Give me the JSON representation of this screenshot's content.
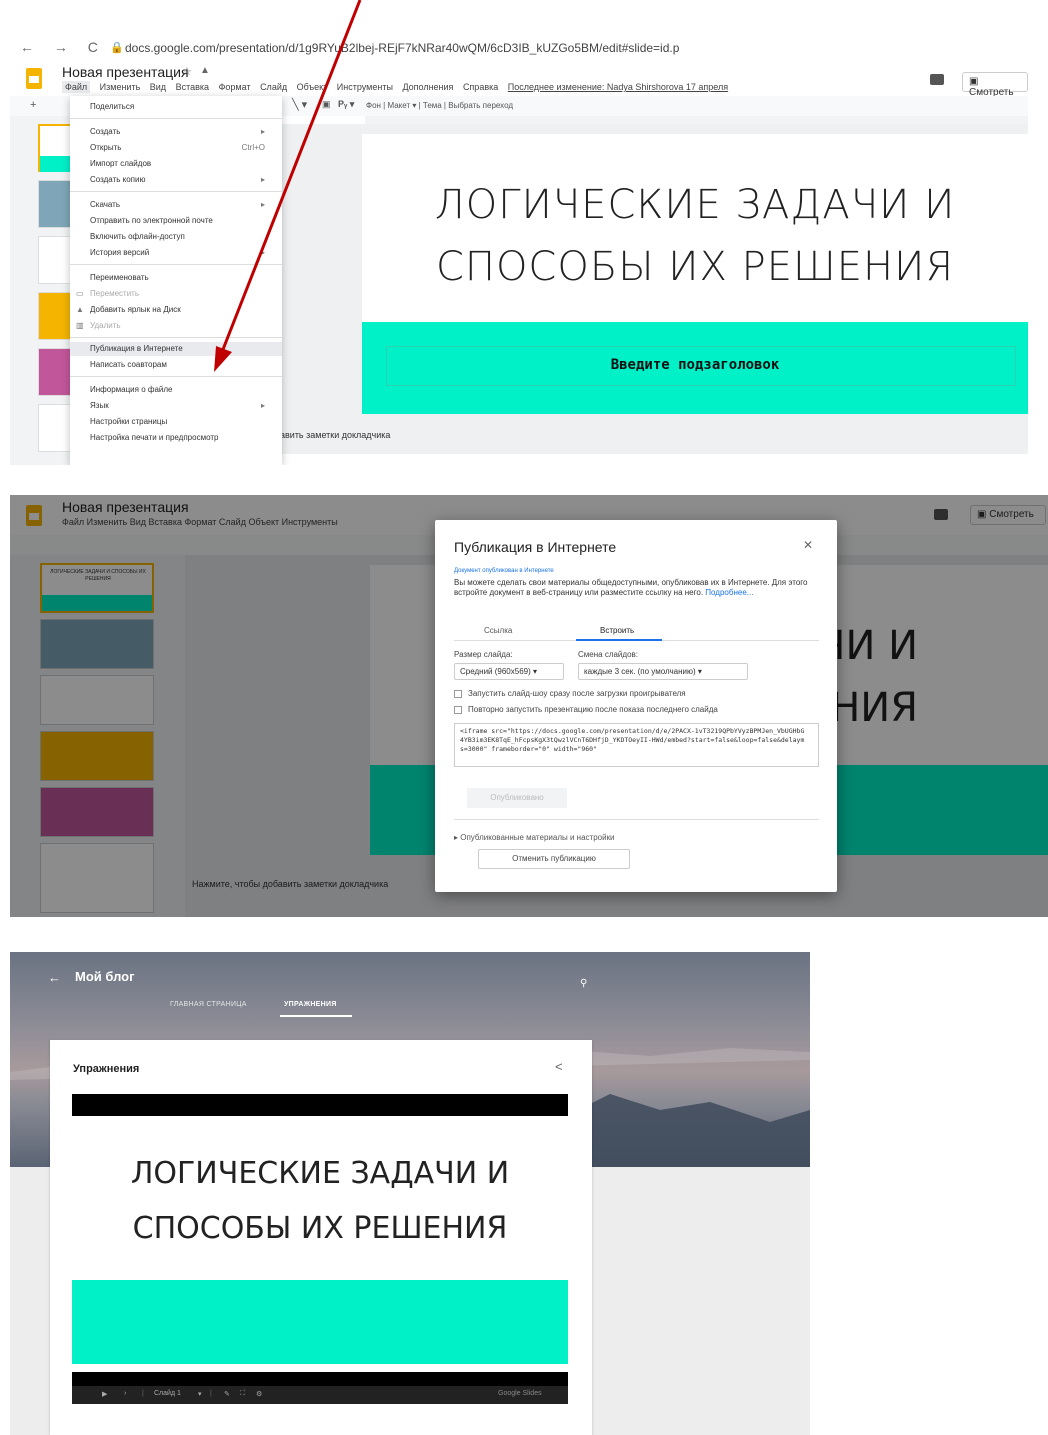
{
  "screen1": {
    "url": "docs.google.com/presentation/d/1g9RYuB2lbej-REjF7kNRar40wQM/6cD3IB_kUZGo5BM/edit#slide=id.p",
    "doc_title": "Новая презентация",
    "menus": [
      "Файл",
      "Изменить",
      "Вид",
      "Вставка",
      "Формат",
      "Слайд",
      "Объект",
      "Инструменты",
      "Дополнения",
      "Справка"
    ],
    "last_edit": "Последнее изменение: Nadya Shirshorova 17 апреля",
    "present_label": "Смотреть",
    "toolbar_items": "Фон   |   Макет ▾   |   Тема   |   Выбрать переход",
    "slide_title_line1": "Логические задачи и",
    "slide_title_line2": "способы их решения",
    "slide_subtitle": "Введите подзаголовок",
    "notes_text": "авить заметки докладчика",
    "file_menu": {
      "share": "Поделиться",
      "create": "Создать",
      "open": "Открыть",
      "open_shortcut": "Ctrl+O",
      "import_slides": "Импорт слайдов",
      "make_copy": "Создать копию",
      "download": "Скачать",
      "email": "Отправить по электронной почте",
      "offline": "Включить офлайн-доступ",
      "version_history": "История версий",
      "rename": "Переименовать",
      "move": "Переместить",
      "add_shortcut": "Добавить ярлык на Диск",
      "delete": "Удалить",
      "publish": "Публикация в Интернете",
      "email_collaborators": "Написать соавторам",
      "file_info": "Информация о файле",
      "language": "Язык",
      "page_setup": "Настройки страницы",
      "print_settings": "Настройка печати и предпросмотр"
    }
  },
  "screen2": {
    "doc_title": "Новая презентация",
    "menus_short": "Файл   Изменить   Вид   Вставка   Формат   Слайд   Объект   Инструменты",
    "present_label": "Смотреть",
    "slide_title_line1": "чи и",
    "slide_title_line2": "ния",
    "notes_text": "Нажмите, чтобы добавить заметки докладчика",
    "thumb1_text": "Логические задачи и способы их решения",
    "dialog": {
      "title": "Публикация в Интернете",
      "status": "Документ опубликован в Интернете",
      "description": "Вы можете сделать свои материалы общедоступными, опубликовав их в Интернете. Для этого встройте документ в веб-страницу или разместите ссылку на него.",
      "more_link": "Подробнее...",
      "tab_link": "Ссылка",
      "tab_embed": "Встроить",
      "size_label": "Размер слайда:",
      "size_value": "Средний (960x569)",
      "advance_label": "Смена слайдов:",
      "advance_value": "каждые 3 сек. (по умолчанию)",
      "autostart": "Запустить слайд-шоу сразу после загрузки проигрывателя",
      "loop": "Повторно запустить презентацию после показа последнего слайда",
      "embed_code": "<iframe src=\"https://docs.google.com/presentation/d/e/2PACX-1vT3219QPbYVyzBPMJen_VbUGHbG4YB3im3EK8TqE_hFcpsKgX3tQwzlVCnT6DHfjD_YKDTOeyII-HWd/embed?start=false&loop=false&delayms=3000\" frameborder=\"0\" width=\"960\"",
      "publish_button": "Опубликовано",
      "published_settings": "Опубликованные материалы и настройки",
      "stop_button": "Отменить публикацию"
    }
  },
  "screen3": {
    "blog_title": "Мой блог",
    "nav_home": "ГЛАВНАЯ СТРАНИЦА",
    "nav_exercises": "УПРАЖНЕНИЯ",
    "card_title": "Упражнения",
    "slide_title_line1": "Логические задачи и",
    "slide_title_line2": "способы их решения",
    "slide_counter": "Слайд 1",
    "brand": "Google Slides"
  },
  "colors": {
    "accent_band": "#00f0c8",
    "arrow": "#c00000",
    "link": "#1a73e8"
  }
}
